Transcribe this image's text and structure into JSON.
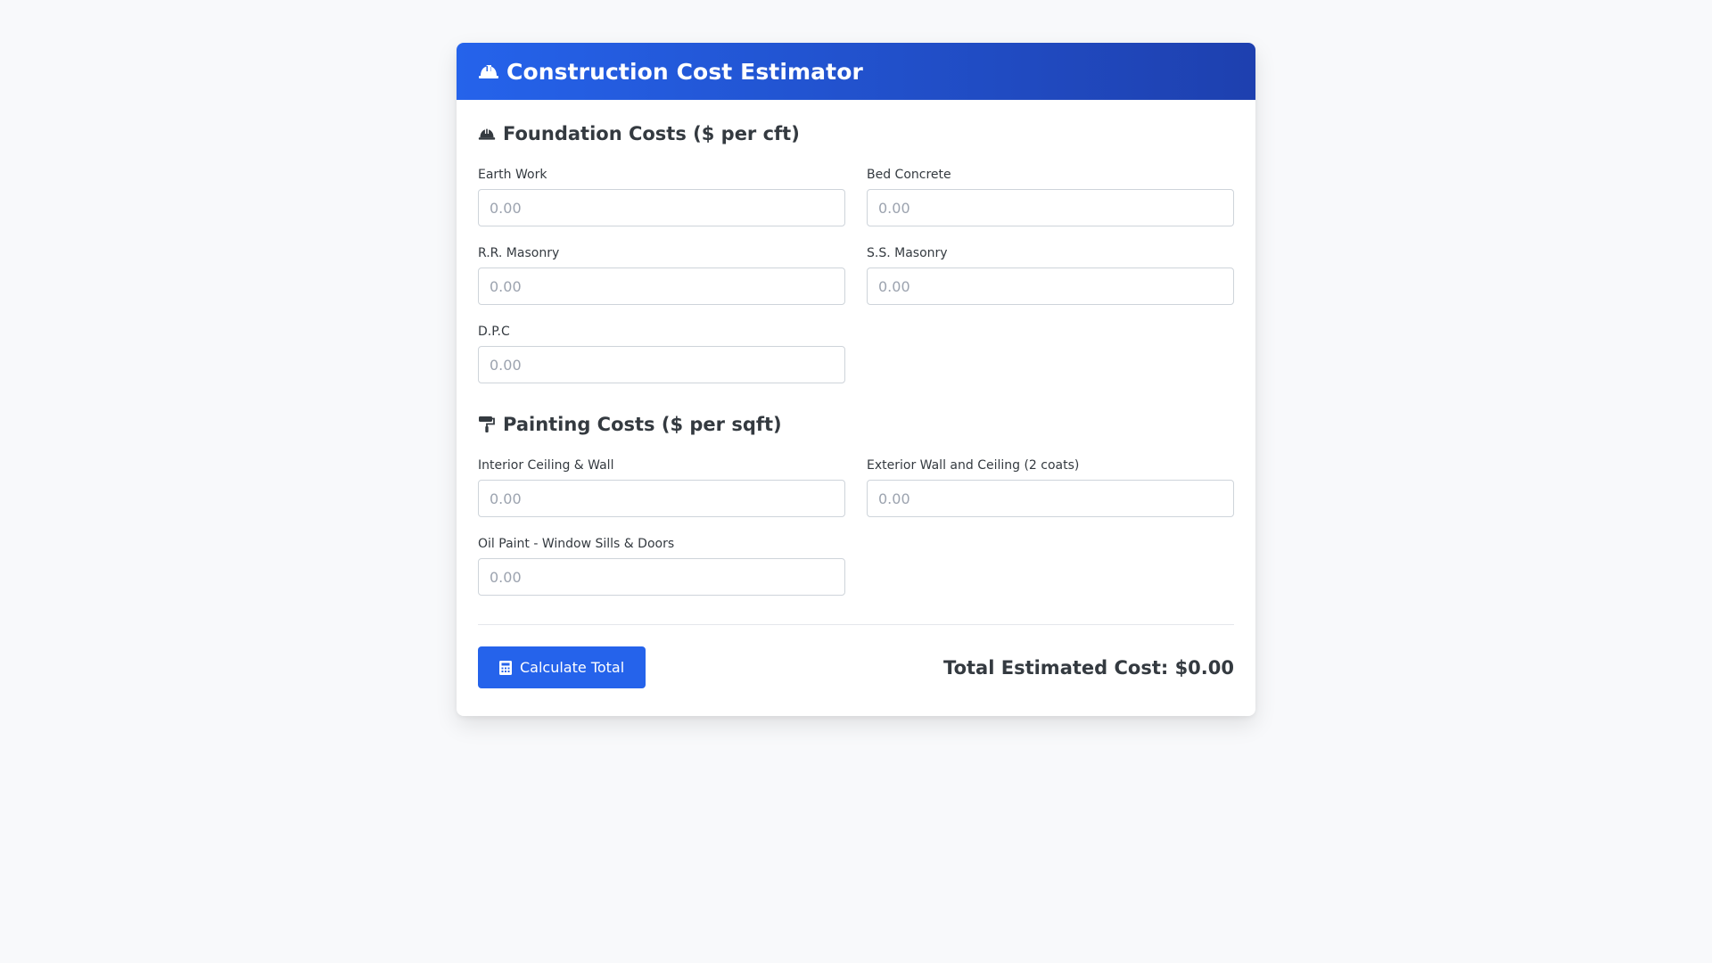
{
  "header": {
    "title": "Construction Cost Estimator",
    "icon": "hard-hat-icon"
  },
  "foundation": {
    "title": "Foundation Costs ($ per cft)",
    "icon": "hard-hat-icon",
    "fields": [
      {
        "label": "Earth Work",
        "placeholder": "0.00",
        "value": ""
      },
      {
        "label": "Bed Concrete",
        "placeholder": "0.00",
        "value": ""
      },
      {
        "label": "R.R. Masonry",
        "placeholder": "0.00",
        "value": ""
      },
      {
        "label": "S.S. Masonry",
        "placeholder": "0.00",
        "value": ""
      },
      {
        "label": "D.P.C",
        "placeholder": "0.00",
        "value": ""
      }
    ]
  },
  "painting": {
    "title": "Painting Costs ($ per sqft)",
    "icon": "paint-roller-icon",
    "fields": [
      {
        "label": "Interior Ceiling & Wall",
        "placeholder": "0.00",
        "value": ""
      },
      {
        "label": "Exterior Wall and Ceiling (2 coats)",
        "placeholder": "0.00",
        "value": ""
      },
      {
        "label": "Oil Paint - Window Sills & Doors",
        "placeholder": "0.00",
        "value": ""
      }
    ]
  },
  "footer": {
    "button_label": "Calculate Total",
    "button_icon": "calculator-icon",
    "total_text": "Total Estimated Cost: $0.00"
  },
  "colors": {
    "accent": "#2563eb",
    "accent_dark": "#1e40af",
    "background": "#f8f9fb",
    "text": "#343a40"
  }
}
